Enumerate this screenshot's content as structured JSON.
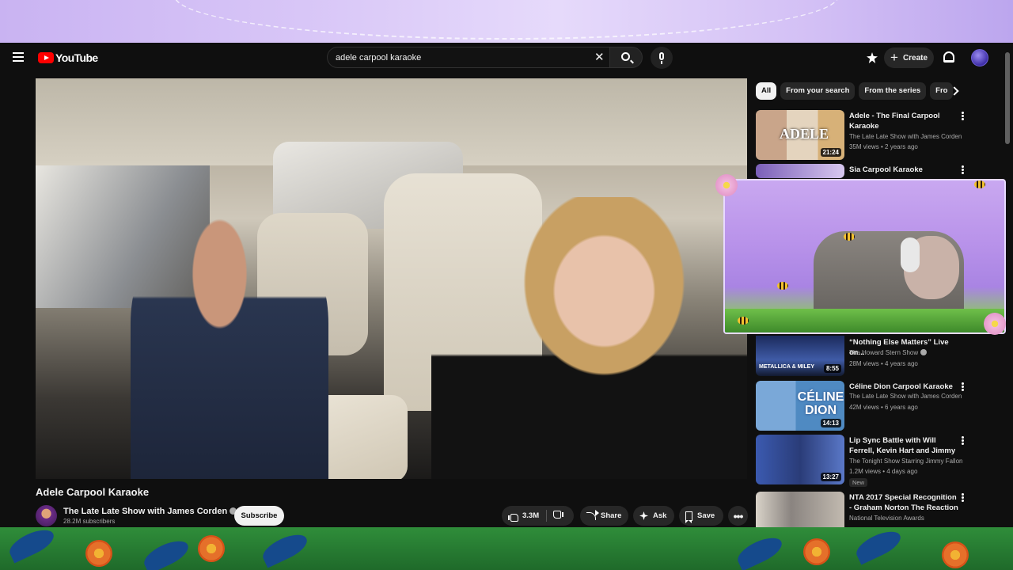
{
  "app": {
    "name": "YouTube"
  },
  "header": {
    "logo_text": "YouTube",
    "search_value": "adele carpool karaoke",
    "create_label": "Create"
  },
  "video": {
    "title": "Adele Carpool Karaoke",
    "channel": "The Late Late Show with James Corden",
    "subscribers": "28.2M subscribers",
    "subscribe_label": "Subscribe",
    "likes": "3.3M",
    "share_label": "Share",
    "ask_label": "Ask",
    "save_label": "Save"
  },
  "chips": [
    "All",
    "From your search",
    "From the series",
    "Fro"
  ],
  "recommendations": [
    {
      "title": "Adele - The Final Carpool Karaoke",
      "channel": "The Late Late Show with James Corden",
      "meta": "35M views • 2 years ago",
      "duration": "21:24",
      "thumb_text": "ADELE"
    },
    {
      "title": "Sia Carpool Karaoke",
      "channel": "",
      "meta": "",
      "duration": "",
      "thumb_text": ""
    },
    {
      "title": "“Nothing Else Matters” Live on...",
      "channel": "The Howard Stern Show",
      "meta": "28M views • 4 years ago",
      "duration": "8:55",
      "thumb_text": "METALLICA & MILEY"
    },
    {
      "title": "Céline Dion Carpool Karaoke",
      "channel": "The Late Late Show with James Corden",
      "meta": "42M views • 6 years ago",
      "duration": "14:13",
      "thumb_text": "CÉLINE DION"
    },
    {
      "title": "Lip Sync Battle with Will Ferrell, Kevin Hart and Jimmy Fallon | ...",
      "channel": "The Tonight Show Starring Jimmy Fallon",
      "meta": "1.2M views • 4 days ago",
      "duration": "13:27",
      "badge": "New"
    },
    {
      "title": "NTA 2017 Special Recognition - Graham Norton The Reaction",
      "channel": "National Television Awards",
      "meta": "",
      "duration": ""
    }
  ],
  "colors": {
    "youtube_red": "#ff0000",
    "background": "#0f0f0f",
    "overlay_purple": "#c9b3f2",
    "overlay_green": "#2f8d3a"
  },
  "icons": [
    "menu-icon",
    "youtube-logo-icon",
    "clear-icon",
    "search-icon",
    "mic-icon",
    "studio-icon",
    "plus-icon",
    "bell-icon",
    "verified-icon",
    "like-icon",
    "dislike-icon",
    "share-icon",
    "ask-sparkle-icon",
    "save-icon",
    "more-icon",
    "kebab-icon",
    "chevron-right-icon"
  ]
}
